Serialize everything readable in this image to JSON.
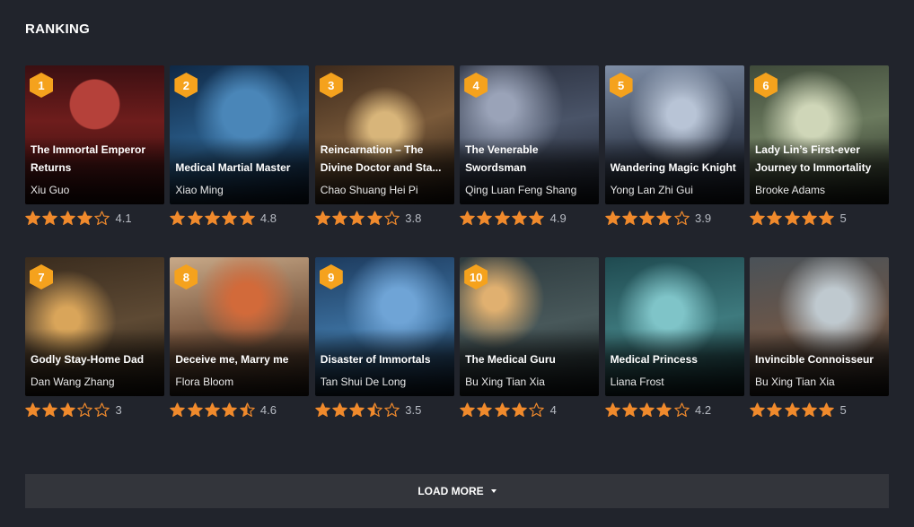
{
  "page": {
    "title": "RANKING"
  },
  "colors": {
    "accent": "#f5a21d",
    "star": "#f08a2c",
    "background": "#21242c"
  },
  "books": [
    {
      "rank": "1",
      "title": "The Immortal Emperor Returns",
      "author": "Xiu Guo",
      "rating": 4.1,
      "rating_label": "4.1",
      "cover_bg": "radial-gradient(circle at 50% 28%, #b5413a 0 20%, transparent 21%), linear-gradient(180deg,#3b0f12 0%,#6e1d1c 40%,#2a0b0c 100%)"
    },
    {
      "rank": "2",
      "title": "Medical Martial Master",
      "author": "Xiao Ming",
      "rating": 4.8,
      "rating_label": "4.8",
      "cover_bg": "radial-gradient(circle at 55% 35%, #4a86b8 0 20%, transparent 45%), linear-gradient(160deg,#0f2845 0%,#2a5d8a 50%,#0b1a2e 100%)"
    },
    {
      "rank": "3",
      "title": "Reincarnation – The Divine Doctor and Sta...",
      "author": "Chao Shuang Hei Pi",
      "rating": 3.8,
      "rating_label": "3.8",
      "cover_bg": "radial-gradient(circle at 50% 45%, #d8b57a 0 15%, transparent 40%), linear-gradient(160deg,#3d2a1c 0%,#7a5a3a 50%,#1e140d 100%)"
    },
    {
      "rank": "4",
      "title": "The Venerable Swordsman",
      "author": "Qing Luan Feng Shang",
      "rating": 4.9,
      "rating_label": "4.9",
      "cover_bg": "radial-gradient(circle at 30% 30%, #9aa3b8 0 10%, transparent 45%), linear-gradient(170deg,#2b3140 0%,#4a5468 45%,#161a24 100%)"
    },
    {
      "rank": "5",
      "title": "Wandering Magic Knight",
      "author": "Yong Lan Zhi Gui",
      "rating": 3.9,
      "rating_label": "3.9",
      "cover_bg": "radial-gradient(circle at 55% 35%, #b8c4d6 0 12%, transparent 45%), linear-gradient(170deg,#7f8ea6 0%,#3a4456 55%,#151922 100%)"
    },
    {
      "rank": "6",
      "title": "Lady Lin’s First-ever Journey to Immortality",
      "author": "Brooke Adams",
      "rating": 5,
      "rating_label": "5",
      "cover_bg": "radial-gradient(circle at 45% 40%, #cfd6b8 0 14%, transparent 45%), linear-gradient(170deg,#3f4a3a 0%,#6b7a5e 45%,#1c2119 100%)"
    },
    {
      "rank": "7",
      "title": "Godly Stay-Home Dad",
      "author": "Dan Wang Zhang",
      "rating": 3,
      "rating_label": "3",
      "cover_bg": "radial-gradient(circle at 30% 45%, #d9a55a 0 10%, transparent 40%), linear-gradient(170deg,#3a2c1e 0%,#5e4a34 50%,#1c150e 100%)"
    },
    {
      "rank": "8",
      "title": "Deceive me, Marry me",
      "author": "Flora Bloom",
      "rating": 4.6,
      "rating_label": "4.6",
      "cover_bg": "radial-gradient(circle at 55% 30%, #d26a3a 0 12%, transparent 40%), linear-gradient(170deg,#c8a988 0%,#7a5840 50%,#2a1e16 100%)"
    },
    {
      "rank": "9",
      "title": "Disaster of Immortals",
      "author": "Tan Shui De Long",
      "rating": 3.5,
      "rating_label": "3.5",
      "cover_bg": "radial-gradient(circle at 60% 35%, #6fa4d6 0 14%, transparent 45%), linear-gradient(170deg,#1d3b5e 0%,#3b6f9e 50%,#0d1a2a 100%)"
    },
    {
      "rank": "10",
      "title": "The Medical Guru",
      "author": "Bu Xing Tian Xia",
      "rating": 4,
      "rating_label": "4",
      "cover_bg": "radial-gradient(circle at 25% 30%, #e0b070 0 8%, transparent 35%), linear-gradient(170deg,#2d3a3e 0%,#48585a 50%,#141a1c 100%)"
    },
    {
      "rank": "",
      "title": "Medical Princess",
      "author": "Liana Frost",
      "rating": 4.2,
      "rating_label": "4.2",
      "cover_bg": "radial-gradient(circle at 45% 40%, #7fc4c8 0 14%, transparent 45%), linear-gradient(170deg,#1f4a50 0%,#3e7a7e 50%,#0e2224 100%)"
    },
    {
      "rank": "",
      "title": "Invincible Connoisseur",
      "author": "Bu Xing Tian Xia",
      "rating": 5,
      "rating_label": "5",
      "cover_bg": "radial-gradient(circle at 60% 35%, #bfc9cf 0 14%, transparent 45%), linear-gradient(170deg,#4a5258 0%,#6c5648 50%,#1a1714 100%)"
    }
  ],
  "load_more": {
    "label": "LOAD MORE",
    "icon": "caret-down-icon"
  }
}
